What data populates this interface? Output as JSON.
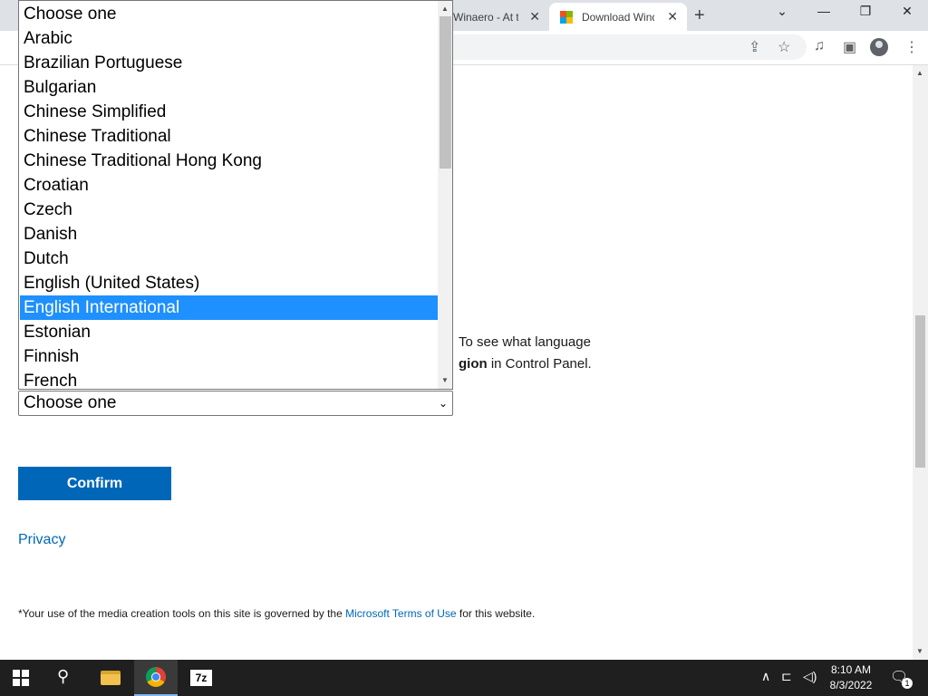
{
  "browser": {
    "tabs": [
      {
        "label": "Winaero - At th",
        "active": false
      },
      {
        "label": "Download Wind",
        "active": true
      }
    ],
    "new_tab_icon": "plus-icon",
    "window_controls": [
      "chevron-down-icon",
      "minimize-icon",
      "restore-icon",
      "close-icon"
    ],
    "toolbar_icons": [
      "share-icon",
      "star-icon",
      "media-icon",
      "sidebar-icon",
      "profile-icon",
      "menu-icon"
    ]
  },
  "page": {
    "instruction_line1": "To see what language",
    "instruction_line2_bold": "gion",
    "instruction_line2_rest": " in Control Panel.",
    "language_select": {
      "selected_label": "Choose one",
      "options": [
        "Choose one",
        "Arabic",
        "Brazilian Portuguese",
        "Bulgarian",
        "Chinese Simplified",
        "Chinese Traditional",
        "Chinese Traditional Hong Kong",
        "Croatian",
        "Czech",
        "Danish",
        "Dutch",
        "English (United States)",
        "English International",
        "Estonian",
        "Finnish",
        "French"
      ],
      "highlighted_option": "English International"
    },
    "confirm_label": "Confirm",
    "privacy_label": "Privacy",
    "footnote_prefix": "*Your use of the media creation tools on this site is governed by the ",
    "footnote_link": "Microsoft Terms of Use",
    "footnote_suffix": " for this website."
  },
  "colors": {
    "accent": "#0067b8",
    "highlight": "#1e90ff",
    "taskbar": "#1f1f1f"
  },
  "taskbar": {
    "apps": [
      "file-explorer-icon",
      "chrome-icon",
      "7zip-icon"
    ],
    "sevenzip_label": "7z",
    "time": "8:10 AM",
    "date": "8/3/2022",
    "notification_count": "1"
  }
}
